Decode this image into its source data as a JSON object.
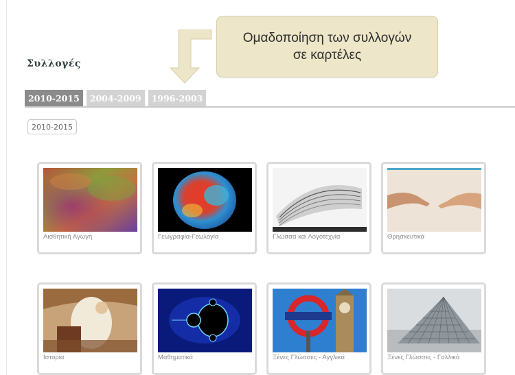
{
  "callout": {
    "line1": "Ομαδοποίηση των συλλογών",
    "line2": "σε καρτέλες"
  },
  "section_title": "Συλλογές",
  "tabs": [
    {
      "label": "2010-2015",
      "active": true
    },
    {
      "label": "2004-2009",
      "active": false
    },
    {
      "label": "1996-2003",
      "active": false
    }
  ],
  "filter_chip": "2010-2015",
  "collections": [
    {
      "caption": "Αισθητική Αγωγή",
      "image": "art-abstract"
    },
    {
      "caption": "Γεωγραφία-Γεωλογία",
      "image": "earth-geoid"
    },
    {
      "caption": "Γλώσσα και Λογοτεχνία",
      "image": "open-book"
    },
    {
      "caption": "Θρησκευτικά",
      "image": "creation-hands"
    },
    {
      "caption": "Ιστορία",
      "image": "classical-painting"
    },
    {
      "caption": "Μαθηματικά",
      "image": "mandelbrot-fractal"
    },
    {
      "caption": "Ξένες Γλώσσες - Αγγλικά",
      "image": "london-underground-bigben"
    },
    {
      "caption": "Ξένες Γλώσσες - Γαλλικά",
      "image": "louvre-pyramid"
    }
  ]
}
